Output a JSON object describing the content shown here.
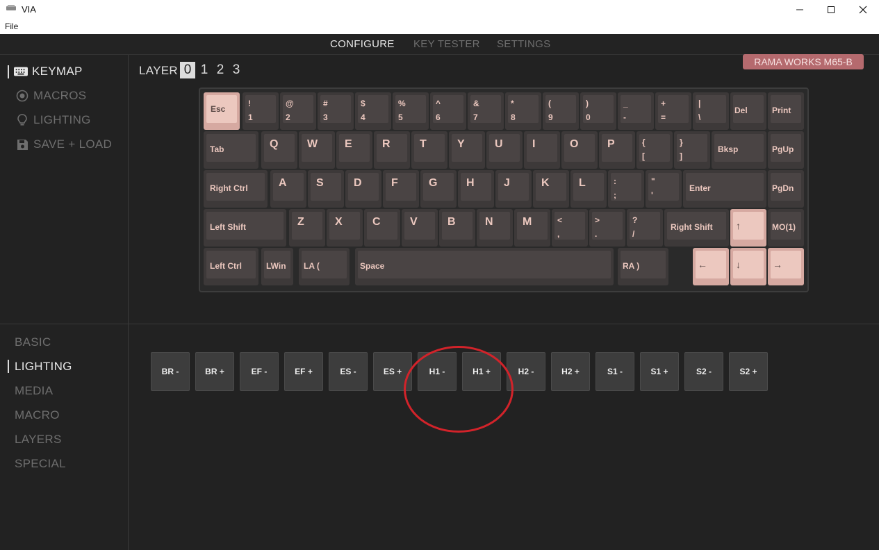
{
  "window": {
    "title": "VIA",
    "menu": [
      "File"
    ]
  },
  "topnav": [
    "CONFIGURE",
    "KEY TESTER",
    "SETTINGS"
  ],
  "sidebar": [
    "KEYMAP",
    "MACROS",
    "LIGHTING",
    "SAVE + LOAD"
  ],
  "sidebar_icons": [
    "keyboard-icon",
    "record-icon",
    "lightbulb-icon",
    "save-icon"
  ],
  "layer": {
    "label": "LAYER",
    "numbers": [
      "0",
      "1",
      "2",
      "3"
    ],
    "selected": "0"
  },
  "keyboard_name": "RAMA WORKS M65-B",
  "keys": {
    "esc": "Esc",
    "num": [
      [
        "!",
        "1"
      ],
      [
        "@",
        "2"
      ],
      [
        "#",
        "3"
      ],
      [
        "$",
        "4"
      ],
      [
        "%",
        "5"
      ],
      [
        "^",
        "6"
      ],
      [
        "&",
        "7"
      ],
      [
        "*",
        "8"
      ],
      [
        "(",
        "9"
      ],
      [
        ")",
        "0"
      ],
      [
        "_",
        "-"
      ],
      [
        "+",
        "="
      ],
      [
        "|",
        "\\"
      ]
    ],
    "del": "Del",
    "print": "Print",
    "tab": "Tab",
    "q_row": [
      "Q",
      "W",
      "E",
      "R",
      "T",
      "Y",
      "U",
      "I",
      "O",
      "P"
    ],
    "lbrace": [
      "{",
      "["
    ],
    "rbrace": [
      "}",
      "]"
    ],
    "bksp": "Bksp",
    "pgup": "PgUp",
    "rctrl_left": "Right Ctrl",
    "a_row": [
      "A",
      "S",
      "D",
      "F",
      "G",
      "H",
      "J",
      "K",
      "L"
    ],
    "semi": [
      ":",
      ";"
    ],
    "quote": [
      "\"",
      "'"
    ],
    "enter": "Enter",
    "pgdn": "PgDn",
    "lshift": "Left Shift",
    "z_row": [
      "Z",
      "X",
      "C",
      "V",
      "B",
      "N",
      "M"
    ],
    "comma": [
      "<",
      ","
    ],
    "period": [
      ">",
      "."
    ],
    "slash": [
      "?",
      "/"
    ],
    "rshift": "Right Shift",
    "up": "↑",
    "mo": "MO(1)",
    "lctrl": "Left Ctrl",
    "lwin": "LWin",
    "la": "LA (",
    "space": "Space",
    "ra": "RA )",
    "left": "←",
    "down": "↓",
    "right": "→"
  },
  "categories": [
    "BASIC",
    "LIGHTING",
    "MEDIA",
    "MACRO",
    "LAYERS",
    "SPECIAL"
  ],
  "active_category": "LIGHTING",
  "lighting_keys": [
    "BR -",
    "BR +",
    "EF -",
    "EF +",
    "ES -",
    "ES +",
    "H1 -",
    "H1 +",
    "H2 -",
    "H2 +",
    "S1 -",
    "S1 +",
    "S2 -",
    "S2 +"
  ],
  "colors": {
    "accent_key": "#ecc8bf",
    "badge": "#b56a6e",
    "annotation": "#d2232a"
  }
}
